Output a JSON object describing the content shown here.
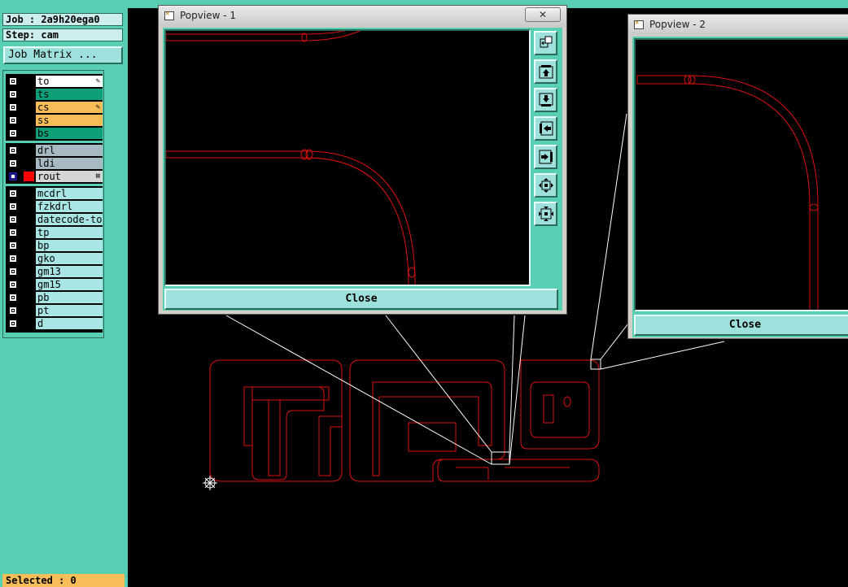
{
  "left_panel": {
    "job_label": "Job : 2a9h20ega0",
    "step_label": "Step: cam",
    "job_matrix_label": "Job Matrix ...",
    "layers": [
      {
        "name": "to",
        "bg": "#ffffff",
        "mark": "✎",
        "check_active": false
      },
      {
        "name": "ts",
        "bg": "#0e9e78",
        "mark": "",
        "check_active": false
      },
      {
        "name": "cs",
        "bg": "#f7bd59",
        "mark": "✎",
        "check_active": false
      },
      {
        "name": "ss",
        "bg": "#f7bd59",
        "mark": "",
        "check_active": false
      },
      {
        "name": "bs",
        "bg": "#0e9e78",
        "mark": "",
        "check_active": false
      },
      {
        "name": "drl",
        "bg": "#a7b9c2",
        "mark": "",
        "check_active": false
      },
      {
        "name": "ldi",
        "bg": "#a7b9c2",
        "mark": "",
        "check_active": false
      },
      {
        "name": "rout",
        "bg": "#d6d6d6",
        "mark": "⊞",
        "check_active": true,
        "color_box": "#ff0000"
      },
      {
        "name": "mcdrl",
        "bg": "#a8e5e5",
        "mark": "",
        "check_active": false
      },
      {
        "name": "fzkdrl",
        "bg": "#a8e5e5",
        "mark": "",
        "check_active": false
      },
      {
        "name": "datecode-to",
        "bg": "#a8e5e5",
        "mark": "",
        "check_active": false
      },
      {
        "name": "tp",
        "bg": "#a8e5e5",
        "mark": "",
        "check_active": false
      },
      {
        "name": "bp",
        "bg": "#a8e5e5",
        "mark": "",
        "check_active": false
      },
      {
        "name": "gko",
        "bg": "#a8e5e5",
        "mark": "",
        "check_active": false
      },
      {
        "name": "gm13",
        "bg": "#a8e5e5",
        "mark": "",
        "check_active": false
      },
      {
        "name": "gm15",
        "bg": "#a8e5e5",
        "mark": "",
        "check_active": false
      },
      {
        "name": "pb",
        "bg": "#a8e5e5",
        "mark": "",
        "check_active": false
      },
      {
        "name": "pt",
        "bg": "#a8e5e5",
        "mark": "",
        "check_active": false
      },
      {
        "name": "d",
        "bg": "#a8e5e5",
        "mark": "",
        "check_active": false
      }
    ],
    "status_text": "Selected : 0"
  },
  "popview1": {
    "title": "Popview - 1",
    "close_x": "✕",
    "close_label": "Close"
  },
  "popview2": {
    "title": "Popview - 2",
    "close_label": "Close"
  },
  "toolbar_icons": [
    "zoom-home-icon",
    "pan-up-icon",
    "pan-down-icon",
    "pan-left-icon",
    "pan-right-icon",
    "zoom-in-icon",
    "zoom-out-icon"
  ],
  "colors": {
    "panel": "#58cfb3",
    "rout_outline": "#dd1111",
    "leader_lines": "#ffffff",
    "canvas": "#000000",
    "status_bar": "#f7bd59"
  }
}
